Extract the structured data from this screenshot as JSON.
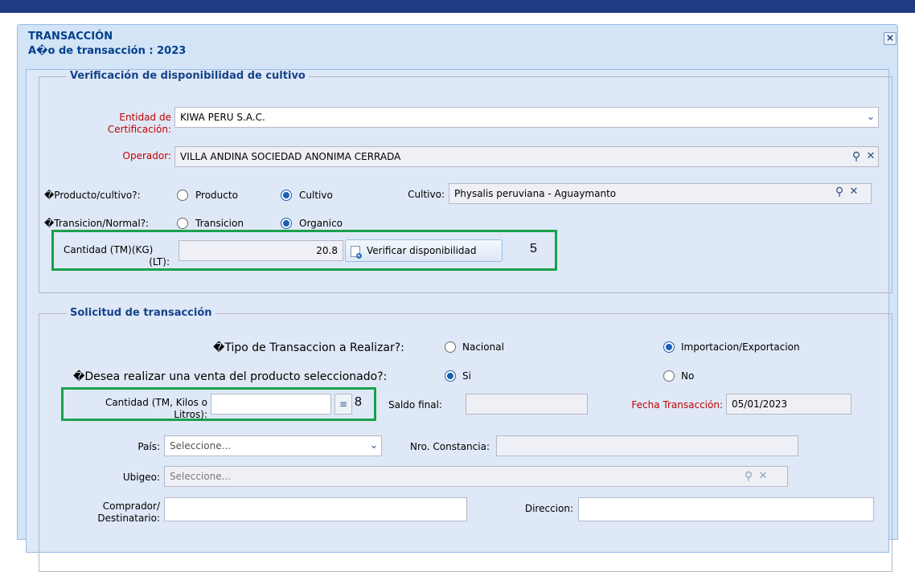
{
  "window": {
    "title": "TRANSACCIÓN",
    "subtitle": "A�o de transacción : 2023",
    "close_icon": "×"
  },
  "verificacion": {
    "legend": "Verificación de disponibilidad de cultivo",
    "entidad_label_1": "Entidad de",
    "entidad_label_2": "Certificación:",
    "entidad_value": "KIWA PERU S.A.C.",
    "operador_label": "Operador:",
    "operador_value": "VILLA ANDINA SOCIEDAD ANONIMA CERRADA",
    "producto_q": "�Producto/cultivo?:",
    "opt_producto": "Producto",
    "opt_cultivo": "Cultivo",
    "cultivo_label": "Cultivo:",
    "cultivo_value": "Physalis  peruviana  - Aguaymanto",
    "transicion_q": "�Transicion/Normal?:",
    "opt_transicion": "Transicion",
    "opt_organico": "Organico",
    "cantidad_label_1": "Cantidad (TM)(KG)",
    "cantidad_label_2": "(LT):",
    "cantidad_value": "20.8",
    "verify_button": "Verificar disponibilidad",
    "annotation": "5"
  },
  "solicitud": {
    "legend": "Solicitud de transacción",
    "tipo_q": "�Tipo de Transaccion a Realizar?:",
    "opt_nacional": "Nacional",
    "opt_import": "Importacion/Exportacion",
    "venta_q": "�Desea realizar una venta del producto seleccionado?:",
    "opt_si": "Si",
    "opt_no": "No",
    "cantidad_label_1": "Cantidad (TM, Kilos o",
    "cantidad_label_2": "Litros):",
    "cantidad_value": "",
    "annotation": "8",
    "saldo_label": "Saldo final:",
    "saldo_value": "",
    "fecha_label": "Fecha Transacción:",
    "fecha_value": "05/01/2023",
    "pais_label": "País:",
    "pais_placeholder": "Seleccione...",
    "constancia_label": "Nro. Constancia:",
    "constancia_value": "",
    "ubigeo_label": "Ubigeo:",
    "ubigeo_placeholder": "Seleccione...",
    "comprador_label_1": "Comprador/",
    "comprador_label_2": "Destinatario:",
    "comprador_value": "",
    "direccion_label": "Direccion:",
    "direccion_value": ""
  },
  "icons": {
    "dropdown": "chevron-down-icon",
    "search": "search-icon",
    "clear": "clear-icon",
    "calc": "calculator-icon",
    "doc": "document-search-icon"
  },
  "colors": {
    "required_label": "#c00000",
    "highlight_box": "#1aa14b",
    "header_text": "#04408c"
  }
}
